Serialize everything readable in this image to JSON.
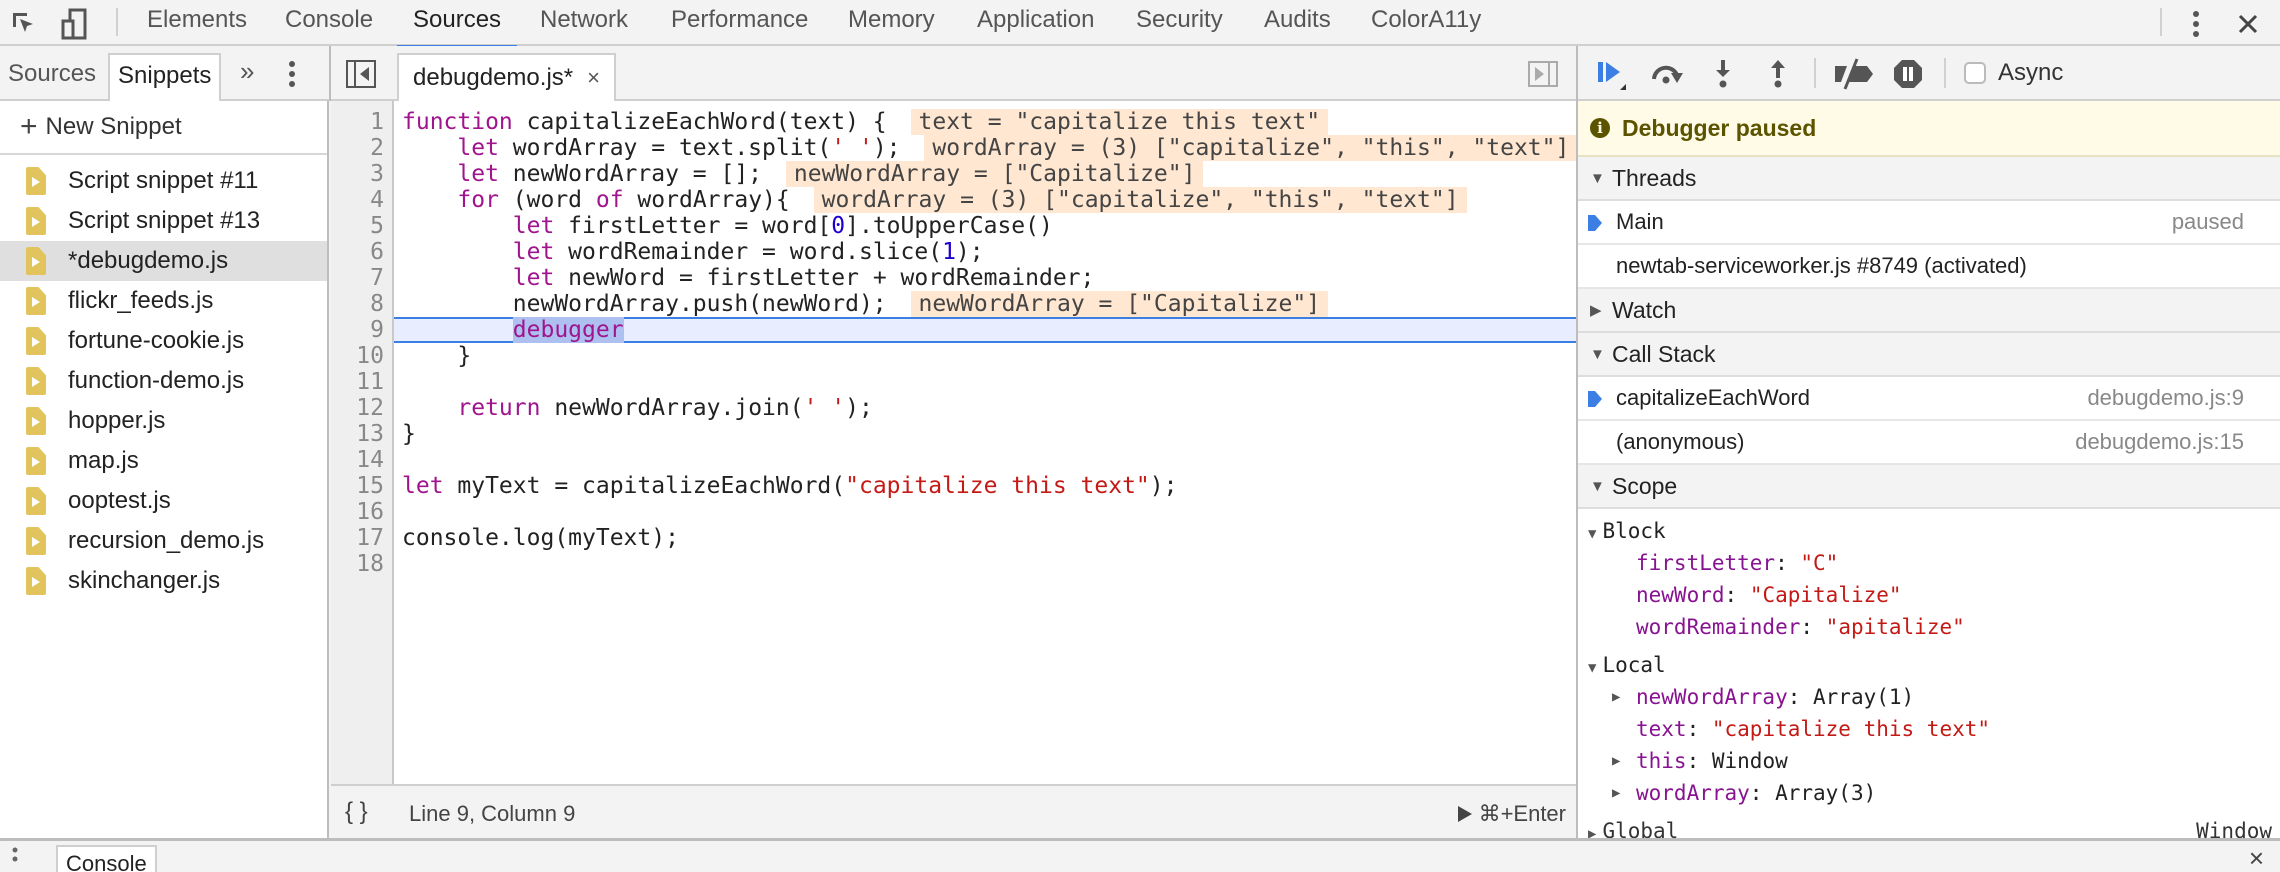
{
  "main_tabs": [
    {
      "label": "Elements"
    },
    {
      "label": "Console"
    },
    {
      "label": "Sources",
      "active": true
    },
    {
      "label": "Network"
    },
    {
      "label": "Performance"
    },
    {
      "label": "Memory"
    },
    {
      "label": "Application"
    },
    {
      "label": "Security"
    },
    {
      "label": "Audits"
    },
    {
      "label": "ColorA11y"
    }
  ],
  "navigator": {
    "tabs": [
      {
        "label": "Sources"
      },
      {
        "label": "Snippets",
        "active": true
      }
    ],
    "more_label": "»",
    "new_snippet_label": "New Snippet",
    "files": [
      {
        "name": "Script snippet #11"
      },
      {
        "name": "Script snippet #13"
      },
      {
        "name": "*debugdemo.js",
        "selected": true
      },
      {
        "name": "flickr_feeds.js"
      },
      {
        "name": "fortune-cookie.js"
      },
      {
        "name": "function-demo.js"
      },
      {
        "name": "hopper.js"
      },
      {
        "name": "map.js"
      },
      {
        "name": "ooptest.js"
      },
      {
        "name": "recursion_demo.js"
      },
      {
        "name": "skinchanger.js"
      }
    ]
  },
  "editor": {
    "tab_label": "debugdemo.js*",
    "tab_close": "×",
    "current_line": 9,
    "line_numbers": [
      "1",
      "2",
      "3",
      "4",
      "5",
      "6",
      "7",
      "8",
      "9",
      "10",
      "11",
      "12",
      "13",
      "14",
      "15",
      "16",
      "17",
      "18"
    ],
    "inline_values": {
      "l1": "text = \"capitalize this text\"",
      "l2": "wordArray = (3) [\"capitalize\", \"this\", \"text\"]",
      "l3": "newWordArray = [\"Capitalize\"]",
      "l4": "wordArray = (3) [\"capitalize\", \"this\", \"text\"]",
      "l8": "newWordArray = [\"Capitalize\"]"
    },
    "status": {
      "format_label": "{ }",
      "position": "Line 9, Column 9",
      "run_label": "⌘+Enter"
    }
  },
  "debugger": {
    "async_label": "Async",
    "async_checked": false,
    "banner": "Debugger paused",
    "threads": {
      "title": "Threads",
      "items": [
        {
          "name": "Main",
          "status": "paused",
          "current": true
        },
        {
          "name": "newtab-serviceworker.js #8749 (activated)",
          "status": ""
        }
      ]
    },
    "watch": {
      "title": "Watch"
    },
    "call_stack": {
      "title": "Call Stack",
      "frames": [
        {
          "name": "capitalizeEachWord",
          "location": "debugdemo.js:9",
          "current": true
        },
        {
          "name": "(anonymous)",
          "location": "debugdemo.js:15"
        }
      ]
    },
    "scope": {
      "title": "Scope",
      "block": {
        "title": "Block",
        "props": [
          {
            "name": "firstLetter",
            "value": "\"C\""
          },
          {
            "name": "newWord",
            "value": "\"Capitalize\""
          },
          {
            "name": "wordRemainder",
            "value": "\"apitalize\""
          }
        ]
      },
      "local": {
        "title": "Local",
        "props": [
          {
            "name": "newWordArray",
            "value": "Array(1)"
          },
          {
            "name": "text",
            "value": "\"capitalize this text\""
          },
          {
            "name": "this",
            "value": "Window"
          },
          {
            "name": "wordArray",
            "value": "Array(3)"
          }
        ]
      },
      "global": {
        "title": "Global",
        "value": "Window"
      }
    }
  },
  "drawer": {
    "tab_label": "Console",
    "close": "×"
  },
  "colors": {
    "accent": "#3b7fe4",
    "keyword": "#a0148e",
    "string": "#c41a16",
    "number": "#1c00cf",
    "inline_value_bg": "#ffe7d1",
    "paused_banner_bg": "#fffbe6",
    "snippet_icon": "#e3c45c"
  }
}
